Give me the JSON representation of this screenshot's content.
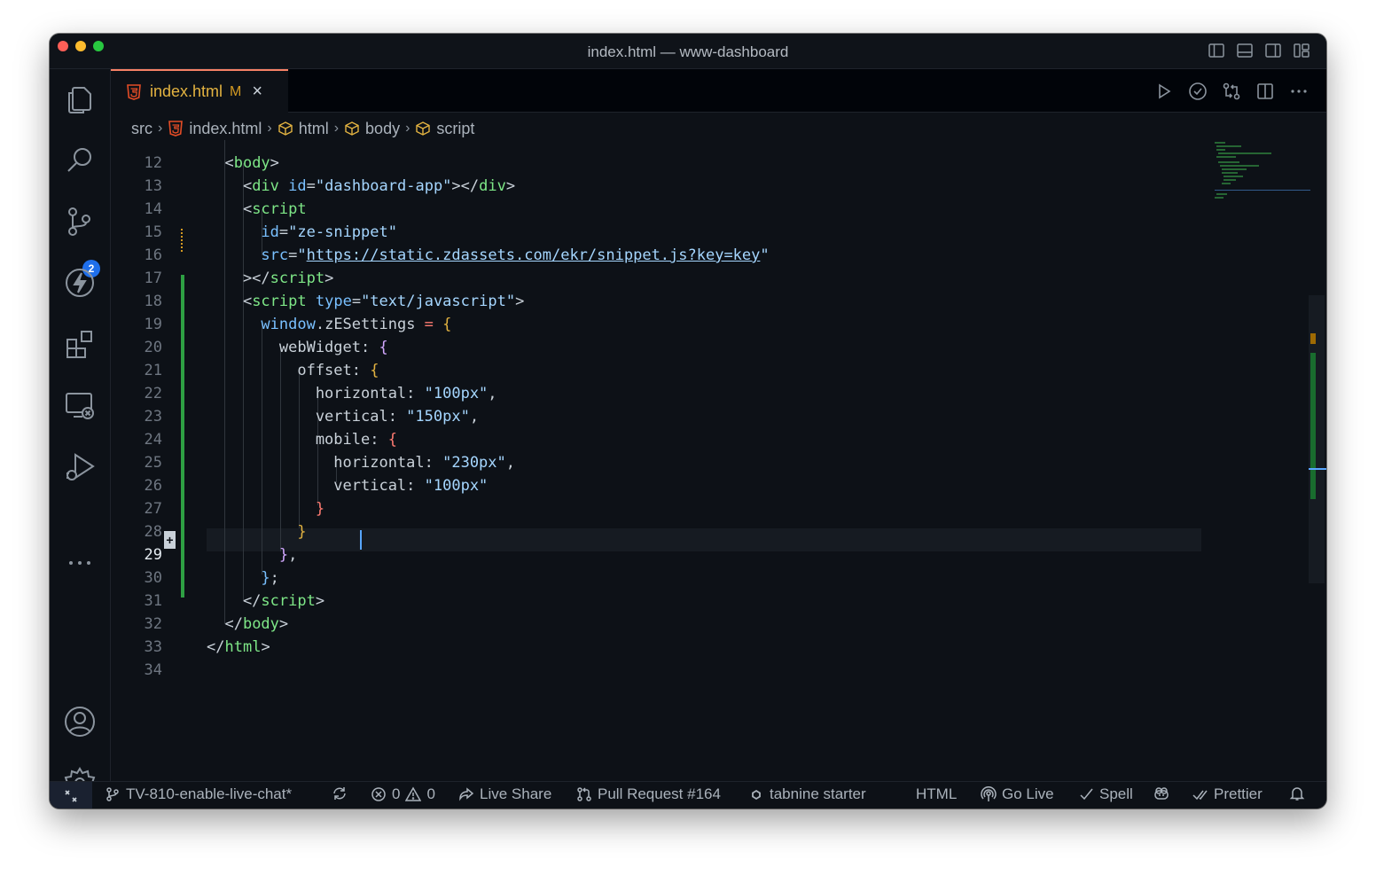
{
  "window": {
    "title": "index.html — www-dashboard"
  },
  "tab": {
    "label": "index.html",
    "modified": "M",
    "close": "×"
  },
  "breadcrumb": {
    "items": [
      "src",
      "index.html",
      "html",
      "body",
      "script"
    ]
  },
  "activity": {
    "scm_badge": "2"
  },
  "editor": {
    "line_numbers": [
      "12",
      "13",
      "14",
      "15",
      "16",
      "17",
      "18",
      "19",
      "20",
      "21",
      "22",
      "23",
      "24",
      "25",
      "26",
      "27",
      "28",
      "29",
      "30",
      "31",
      "32",
      "33",
      "34"
    ],
    "active_line": "29",
    "lines": [
      [
        [
          "c-punct",
          "  <"
        ],
        [
          "c-tag",
          "body"
        ],
        [
          "c-punct",
          ">"
        ]
      ],
      [
        [
          "c-punct",
          "    <"
        ],
        [
          "c-tag",
          "div"
        ],
        [
          "c-punct",
          " "
        ],
        [
          "c-attr",
          "id"
        ],
        [
          "c-punct",
          "="
        ],
        [
          "c-str",
          "\"dashboard-app\""
        ],
        [
          "c-punct",
          "></"
        ],
        [
          "c-tag",
          "div"
        ],
        [
          "c-punct",
          ">"
        ]
      ],
      [
        [
          "c-punct",
          "    <"
        ],
        [
          "c-tag",
          "script"
        ]
      ],
      [
        [
          "c-punct",
          "      "
        ],
        [
          "c-attr",
          "id"
        ],
        [
          "c-punct",
          "="
        ],
        [
          "c-str",
          "\"ze-snippet\""
        ]
      ],
      [
        [
          "c-punct",
          "      "
        ],
        [
          "c-attr",
          "src"
        ],
        [
          "c-punct",
          "="
        ],
        [
          "c-str",
          "\""
        ],
        [
          "c-link",
          "https://static.zdassets.com/ekr/snippet.js?key=key"
        ],
        [
          "c-str",
          "\""
        ]
      ],
      [
        [
          "c-punct",
          "    ></"
        ],
        [
          "c-tag",
          "script"
        ],
        [
          "c-punct",
          ">"
        ]
      ],
      [
        [
          "c-punct",
          "    <"
        ],
        [
          "c-tag",
          "script"
        ],
        [
          "c-punct",
          " "
        ],
        [
          "c-attr",
          "type"
        ],
        [
          "c-punct",
          "="
        ],
        [
          "c-str",
          "\"text/javascript\""
        ],
        [
          "c-punct",
          ">"
        ]
      ],
      [
        [
          "c-punct",
          "      "
        ],
        [
          "c-var",
          "window"
        ],
        [
          "c-punct",
          ".zESettings "
        ],
        [
          "c-op",
          "="
        ],
        [
          "c-punct",
          " "
        ],
        [
          "c-b1",
          "{"
        ]
      ],
      [
        [
          "c-punct",
          "        webWidget: "
        ],
        [
          "c-b3",
          "{"
        ]
      ],
      [
        [
          "c-punct",
          "          offset: "
        ],
        [
          "c-b1",
          "{"
        ]
      ],
      [
        [
          "c-punct",
          "            horizontal: "
        ],
        [
          "c-str",
          "\"100px\""
        ],
        [
          "c-punct",
          ","
        ]
      ],
      [
        [
          "c-punct",
          "            vertical: "
        ],
        [
          "c-str",
          "\"150px\""
        ],
        [
          "c-punct",
          ","
        ]
      ],
      [
        [
          "c-punct",
          "            mobile: "
        ],
        [
          "c-b2",
          "{"
        ]
      ],
      [
        [
          "c-punct",
          "              horizontal: "
        ],
        [
          "c-str",
          "\"230px\""
        ],
        [
          "c-punct",
          ","
        ]
      ],
      [
        [
          "c-punct",
          "              vertical: "
        ],
        [
          "c-str",
          "\"100px\""
        ]
      ],
      [
        [
          "c-punct",
          "            "
        ],
        [
          "c-b2",
          "}"
        ]
      ],
      [
        [
          "c-punct",
          "          "
        ],
        [
          "c-b1",
          "}"
        ]
      ],
      [
        [
          "c-punct",
          "        "
        ],
        [
          "c-b3",
          "}"
        ],
        [
          "c-punct",
          ","
        ]
      ],
      [
        [
          "c-punct",
          "      "
        ],
        [
          "c-b4",
          "}"
        ],
        [
          "c-punct",
          ";"
        ]
      ],
      [
        [
          "c-punct",
          "    </"
        ],
        [
          "c-tag",
          "script"
        ],
        [
          "c-punct",
          ">"
        ]
      ],
      [
        [
          "c-punct",
          "  </"
        ],
        [
          "c-tag",
          "body"
        ],
        [
          "c-punct",
          ">"
        ]
      ],
      [
        [
          "c-punct",
          "</"
        ],
        [
          "c-tag",
          "html"
        ],
        [
          "c-punct",
          ">"
        ]
      ],
      []
    ]
  },
  "statusbar": {
    "branch": "TV-810-enable-live-chat*",
    "errors": "0",
    "warnings": "0",
    "live_share": "Live Share",
    "pull_request": "Pull Request #164",
    "tabnine": "tabnine starter",
    "language": "HTML",
    "go_live": "Go Live",
    "spell": "Spell",
    "prettier": "Prettier"
  },
  "colors": {
    "accent": "#1f6feb",
    "tab_border": "#f78166",
    "diff_added": "#2ea043",
    "modified": "#d29922"
  }
}
